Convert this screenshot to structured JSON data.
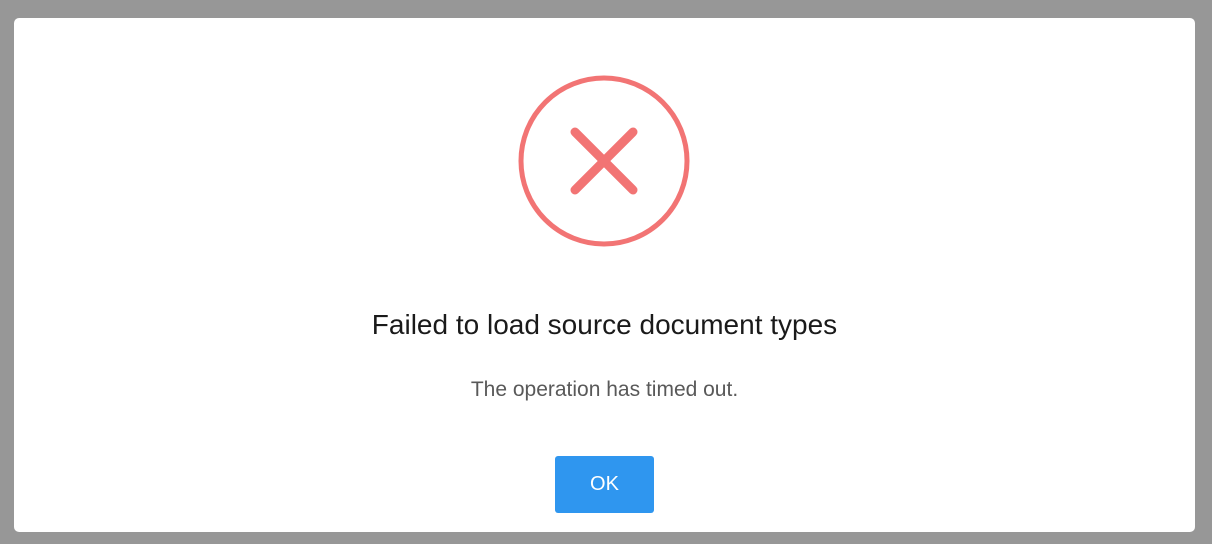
{
  "dialog": {
    "icon": "error-x-circle-icon",
    "title": "Failed to load source document types",
    "message": "The operation has timed out.",
    "ok_label": "OK"
  },
  "colors": {
    "backdrop": "#979797",
    "dialog_background": "#ffffff",
    "error_icon": "#f27474",
    "button_background": "#2f96ef",
    "button_text": "#ffffff",
    "title_text": "#1a1a1a",
    "message_text": "#595959"
  }
}
